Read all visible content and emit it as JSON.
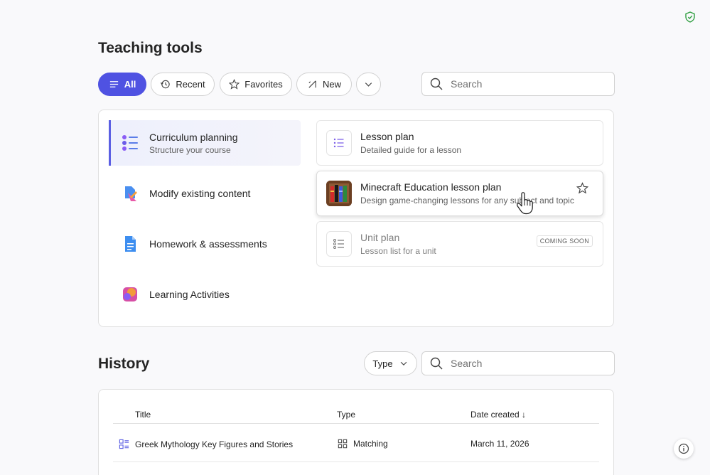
{
  "page": {
    "title": "Teaching tools"
  },
  "filters": {
    "all": "All",
    "recent": "Recent",
    "favorites": "Favorites",
    "new": "New"
  },
  "search": {
    "placeholder": "Search"
  },
  "categories": [
    {
      "title": "Curriculum planning",
      "subtitle": "Structure your course"
    },
    {
      "title": "Modify existing content"
    },
    {
      "title": "Homework & assessments"
    },
    {
      "title": "Learning Activities"
    }
  ],
  "tools": [
    {
      "title": "Lesson plan",
      "subtitle": "Detailed guide for a lesson"
    },
    {
      "title": "Minecraft Education lesson plan",
      "subtitle": "Design game-changing lessons for any subject and topic"
    },
    {
      "title": "Unit plan",
      "subtitle": "Lesson list for a unit",
      "badge": "COMING SOON"
    }
  ],
  "history": {
    "title": "History",
    "type_filter": "Type",
    "search_placeholder": "Search",
    "columns": {
      "title": "Title",
      "type": "Type",
      "date": "Date created ↓"
    },
    "rows": [
      {
        "title": "Greek Mythology Key Figures and Stories",
        "type": "Matching",
        "date": "March 11, 2026"
      }
    ]
  },
  "colors": {
    "accent": "#4f52e2",
    "shield": "#2e9e3f"
  }
}
